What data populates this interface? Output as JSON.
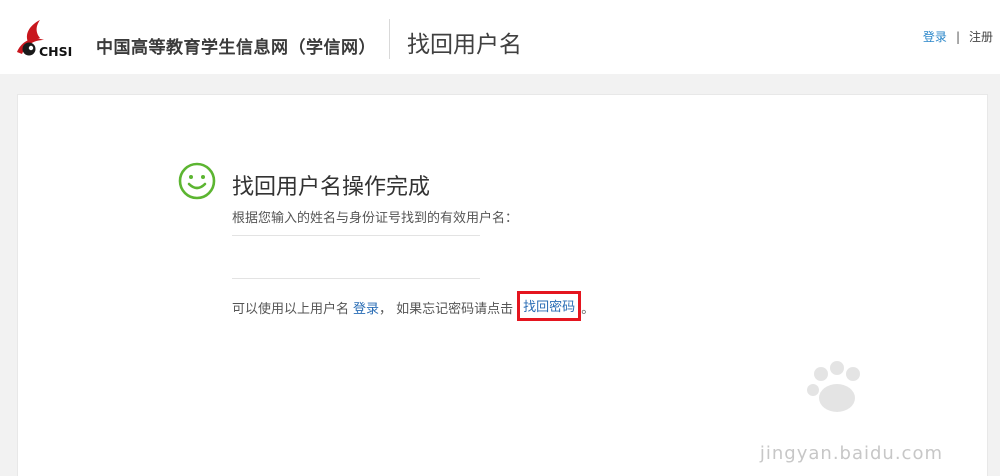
{
  "header": {
    "logo_text": "CHSI",
    "site_name": "中国高等教育学生信息网（学信网）",
    "page_title": "找回用户名",
    "login_link": "登录",
    "separator": "|",
    "register_link": "注册"
  },
  "result": {
    "title": "找回用户名操作完成",
    "description": "根据您输入的姓名与身份证号找到的有效用户名：",
    "hint_prefix": "可以使用以上用户名",
    "login_link": "登录",
    "hint_middle": "，  如果忘记密码请点击",
    "reset_link": "找回密码",
    "hint_suffix": "。"
  },
  "watermark": {
    "text": "jingyan.baidu.com"
  },
  "colors": {
    "accent_blue": "#2a86c9",
    "link_blue": "#2a6db5",
    "highlight_red": "#e4151f",
    "smile_green": "#5cb531",
    "logo_red": "#c8161d"
  }
}
